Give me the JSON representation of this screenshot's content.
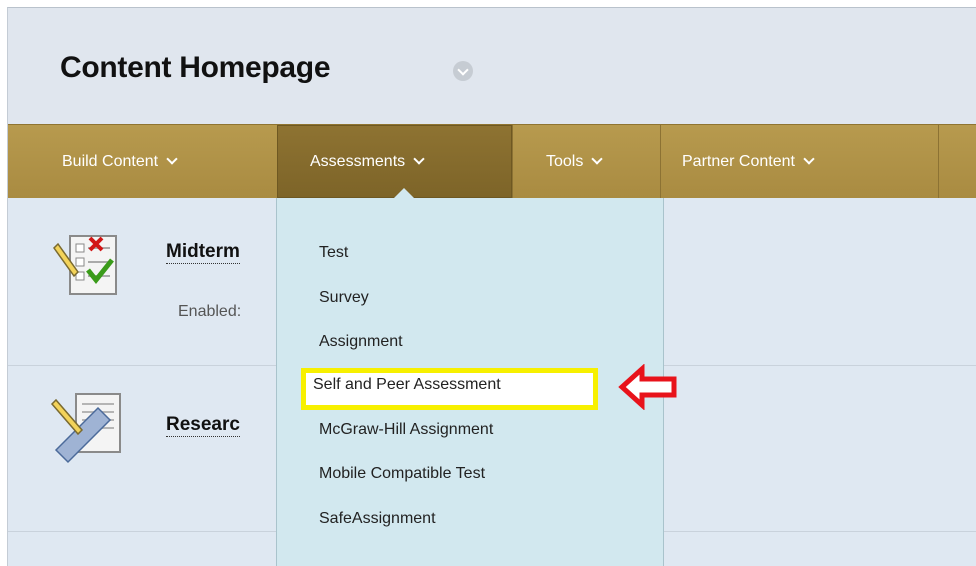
{
  "page": {
    "title": "Content Homepage"
  },
  "actionbar": {
    "buttons": [
      {
        "label": "Build Content"
      },
      {
        "label": "Assessments"
      },
      {
        "label": "Tools"
      },
      {
        "label": "Partner Content"
      }
    ]
  },
  "content": {
    "items": [
      {
        "title": "Midterm",
        "meta": "Enabled:"
      },
      {
        "title": "Researc"
      }
    ]
  },
  "dropdown": {
    "items": [
      {
        "label": "Test"
      },
      {
        "label": "Survey"
      },
      {
        "label": "Assignment"
      },
      {
        "label": "Self and Peer Assessment",
        "highlighted": true
      },
      {
        "label": "McGraw-Hill Assignment"
      },
      {
        "label": "Mobile Compatible Test"
      },
      {
        "label": "SafeAssignment"
      }
    ]
  },
  "colors": {
    "actionbar": "#ae9045",
    "highlight": "#f7f000",
    "arrow": "#e8131b",
    "dropdown_bg": "#d2e8ef"
  },
  "icons": {
    "item1": "test-checklist-icon",
    "item2": "assignment-ruler-icon",
    "arrow": "red-arrow-icon"
  }
}
